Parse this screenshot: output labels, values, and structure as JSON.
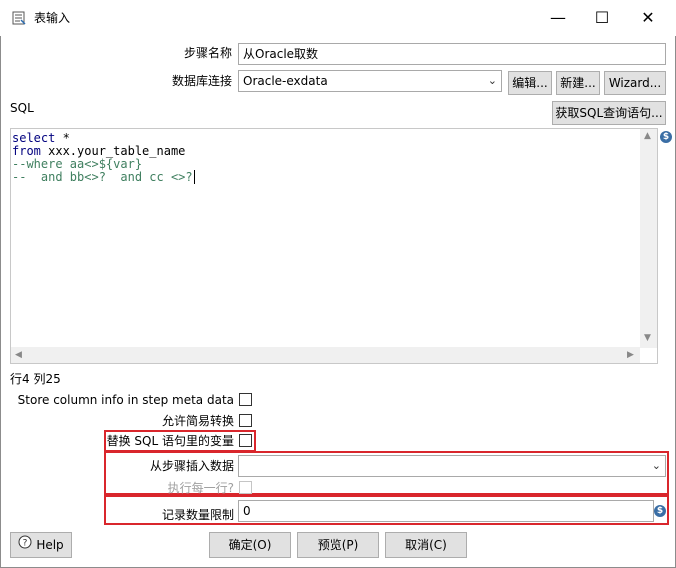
{
  "window": {
    "title": "表输入",
    "minimize_glyph": "—",
    "maximize_glyph": "☐",
    "close_glyph": "✕"
  },
  "step_name": {
    "label": "步骤名称",
    "value": "从Oracle取数"
  },
  "db_connection": {
    "label": "数据库连接",
    "value": "Oracle-exdata",
    "edit_button": "编辑...",
    "new_button": "新建...",
    "wizard_button": "Wizard..."
  },
  "sql": {
    "label": "SQL",
    "get_sql_button": "获取SQL查询语句...",
    "lines": [
      {
        "kw": "select",
        "rest": " *"
      },
      {
        "kw": "from",
        "rest": " xxx.your_table_name"
      },
      {
        "comment": "--where aa<>${var}"
      },
      {
        "comment": "--  and bb<>?  and cc <>?"
      }
    ]
  },
  "cursor_position": "行4 列25",
  "options": {
    "store_column_info": "Store column info in step meta data",
    "lazy_conversion": "允许简易转换",
    "replace_variables": "替换 SQL 语句里的变量",
    "insert_from_step": "从步骤插入数据",
    "execute_each_row": "执行每一行?",
    "limit_label": "记录数量限制",
    "limit_value": "0"
  },
  "footer": {
    "help": "Help",
    "ok": "确定(O)",
    "preview": "预览(P)",
    "cancel": "取消(C)"
  },
  "colors": {
    "highlight_border": "#d9262c",
    "sql_keyword": "#00007f",
    "sql_comment": "#3f7f5f"
  }
}
